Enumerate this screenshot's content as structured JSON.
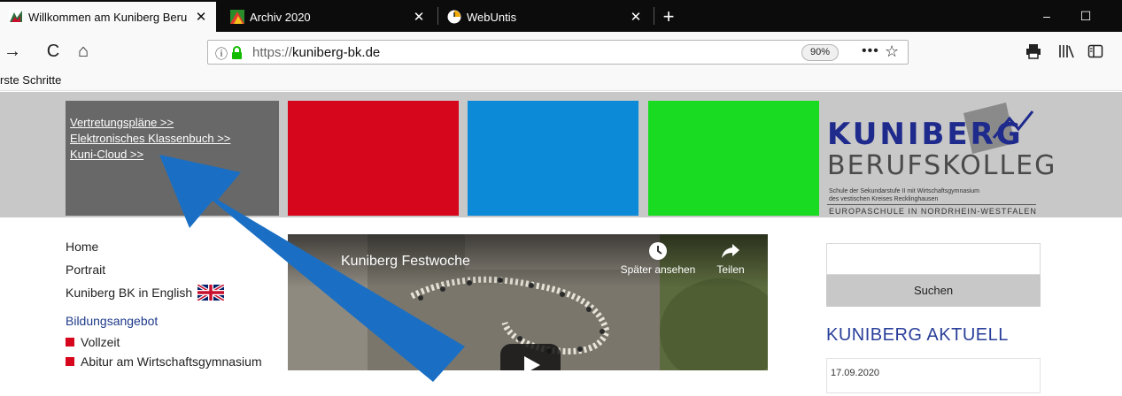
{
  "browser": {
    "tabs": [
      {
        "title": "Willkommen am Kuniberg Beru",
        "close": "✕",
        "state": "active"
      },
      {
        "title": "Archiv 2020",
        "close": "✕",
        "state": "inactive"
      },
      {
        "title": "WebUntis",
        "close": "✕",
        "state": "inactive"
      }
    ],
    "new_tab": "+",
    "window": {
      "minimize": "–",
      "maximize": "☐"
    },
    "nav": {
      "forward": "→",
      "reload": "C",
      "home": "⌂"
    },
    "address": {
      "info": "ⓘ",
      "url_prefix": "https://",
      "url_domain": "kuniberg-bk.de",
      "zoom": "90%",
      "more": "•••",
      "star": "☆"
    },
    "toolbar": {
      "print": "print-icon",
      "library": "library-icon",
      "sidebar": "sidebar-icon"
    },
    "bookmarks": {
      "first": "rste Schritte"
    }
  },
  "page": {
    "quicklinks": [
      "Vertretungspläne >>",
      "Elektronisches Klassenbuch >>",
      "Kuni-Cloud >>"
    ],
    "tile_colors": {
      "gray": "#686868",
      "red": "#d6061d",
      "blue": "#0c8ad8",
      "green": "#19db21"
    },
    "logo": {
      "line1": "KUNIBERG",
      "line2": "BERUFSKOLLEG",
      "line3a": "Schule der Sekundarstufe II mit Wirtschaftsgymnasium",
      "line3b": "des vestischen Kreises Recklinghausen",
      "line4": "EUROPASCHULE IN NORDRHEIN-WESTFALEN"
    },
    "sidenav": {
      "items": [
        "Home",
        "Portrait",
        "Kuniberg BK in English"
      ],
      "heading": "Bildungsangebot",
      "sub": [
        "Vollzeit",
        "Abitur am Wirtschaftsgymnasium"
      ]
    },
    "video": {
      "title": "Kuniberg Festwoche",
      "watch_later": "Später ansehen",
      "share": "Teilen"
    },
    "search": {
      "button": "Suchen"
    },
    "news": {
      "heading": "KUNIBERG AKTUELL",
      "first_date": "17.09.2020"
    },
    "annotation": {
      "arrow_color": "#1a6fc4"
    }
  }
}
